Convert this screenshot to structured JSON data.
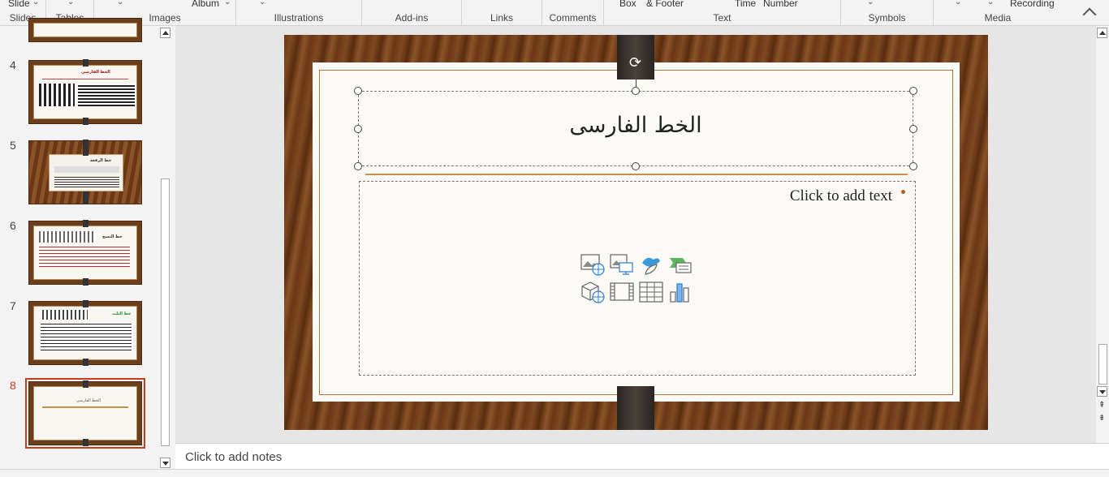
{
  "ribbon": {
    "slide_label": "Slide",
    "album_label": "Album",
    "box_label": "Box",
    "footer_label": "& Footer",
    "time_label": "Time",
    "number_label": "Number",
    "recording_label": "Recording",
    "groups": {
      "slides": "Slides",
      "tables": "Tables",
      "images": "Images",
      "illustrations": "Illustrations",
      "addins": "Add-ins",
      "links": "Links",
      "comments": "Comments",
      "text": "Text",
      "symbols": "Symbols",
      "media": "Media"
    }
  },
  "thumbnails": {
    "items": [
      {
        "number": "4",
        "title": "الخط الفارسي"
      },
      {
        "number": "5",
        "title": "خط الرقعة"
      },
      {
        "number": "6",
        "title": "خط النسخ"
      },
      {
        "number": "7",
        "title": "خط الثلث"
      },
      {
        "number": "8",
        "title": "الخط الفارسى"
      }
    ]
  },
  "slide": {
    "title": "الخط الفارسى",
    "content_placeholder": "Click to add text"
  },
  "notes": {
    "placeholder": "Click to add notes"
  },
  "icons": {
    "content": [
      "insert-picture-icon",
      "stock-images-icon",
      "icons-icon",
      "smartart-icon",
      "3d-models-icon",
      "video-icon",
      "table-icon",
      "chart-icon"
    ]
  },
  "colors": {
    "accent": "#c43e1c",
    "wood": "#6b3716"
  }
}
